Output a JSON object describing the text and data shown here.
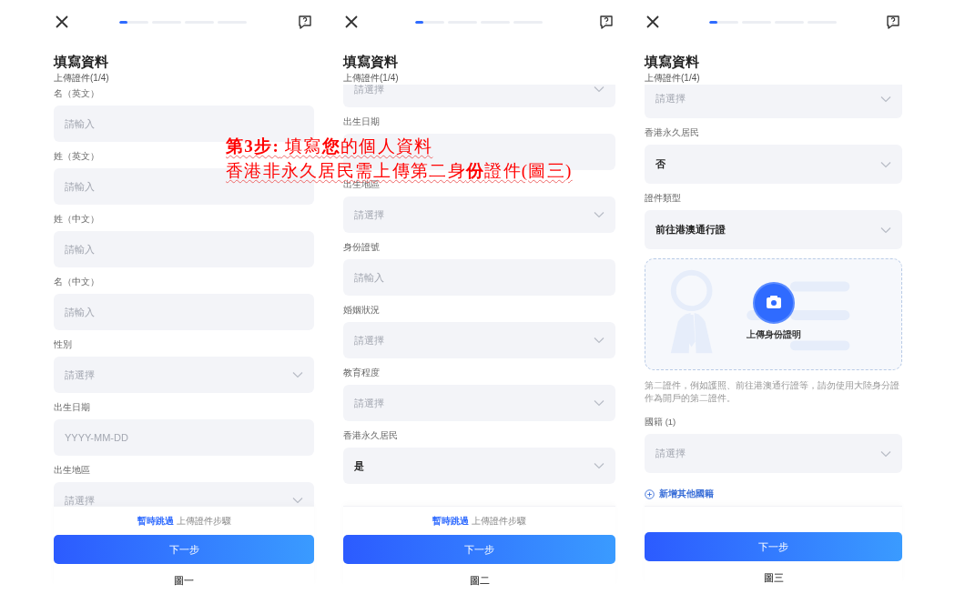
{
  "annotation": {
    "lines": [
      "**第3步:** 填寫**您**的個人資料",
      "香港非永久居民需上傳第二身**份**證件(圖三)"
    ]
  },
  "screens": [
    {
      "steps": [
        {
          "selected": true
        },
        {
          "selected": false
        },
        {
          "selected": false
        },
        {
          "selected": false
        }
      ],
      "title": "填寫資料",
      "subtitle": "上傳證件(1/4)",
      "items": [
        {
          "kind": "input",
          "label": "名（英文）",
          "placeholder": "請輸入"
        },
        {
          "kind": "input",
          "label": "姓（英文）",
          "placeholder": "請輸入"
        },
        {
          "kind": "input",
          "label": "姓（中文）",
          "placeholder": "請輸入"
        },
        {
          "kind": "input",
          "label": "名（中文）",
          "placeholder": "請輸入"
        },
        {
          "kind": "select",
          "label": "性別",
          "placeholder": "請選擇"
        },
        {
          "kind": "input",
          "label": "出生日期",
          "placeholder": "YYYY-MM-DD"
        },
        {
          "kind": "select",
          "label": "出生地區",
          "placeholder": "請選擇"
        }
      ],
      "skip": {
        "link": "暫時跳過",
        "text": "上傳證件步驟"
      },
      "button": "下一步",
      "caption": "圖一"
    },
    {
      "steps": [
        {
          "selected": true
        },
        {
          "selected": false
        },
        {
          "selected": false
        },
        {
          "selected": false
        }
      ],
      "title": "填寫資料",
      "subtitle": "上傳證件(1/4)",
      "items": [
        {
          "kind": "select",
          "placeholder": "請選擇"
        },
        {
          "kind": "input",
          "label": "出生日期"
        },
        {
          "kind": "select",
          "label": "出生地區",
          "placeholder": "請選擇"
        },
        {
          "kind": "input",
          "label": "身份證號",
          "placeholder": "請輸入"
        },
        {
          "kind": "select",
          "label": "婚姻狀況",
          "placeholder": "請選擇"
        },
        {
          "kind": "select",
          "label": "教育程度",
          "placeholder": "請選擇"
        },
        {
          "kind": "select",
          "label": "香港永久居民",
          "value": "是"
        }
      ],
      "skip": {
        "link": "暫時跳過",
        "text": "上傳證件步驟"
      },
      "button": "下一步",
      "caption": "圖二"
    },
    {
      "steps": [
        {
          "selected": true
        },
        {
          "selected": false
        },
        {
          "selected": false
        },
        {
          "selected": false
        }
      ],
      "title": "填寫資料",
      "subtitle": "上傳證件(1/4)",
      "items": [
        {
          "kind": "select",
          "placeholder": "請選擇"
        },
        {
          "kind": "select",
          "label": "香港永久居民",
          "value": "否"
        },
        {
          "kind": "select",
          "label": "證件類型",
          "value": "前往港澳通行證"
        },
        {
          "kind": "upload",
          "text": "上傳身份證明"
        },
        {
          "kind": "note",
          "text": "第二證件，例如護照、前往港澳通行證等，請勿使用大陸身分證作為開戶的第二證件。"
        },
        {
          "kind": "select",
          "label": "國籍 (1)",
          "placeholder": "請選擇"
        },
        {
          "kind": "add",
          "text": "新增其他國籍"
        }
      ],
      "button": "下一步",
      "caption": "圖三"
    }
  ]
}
